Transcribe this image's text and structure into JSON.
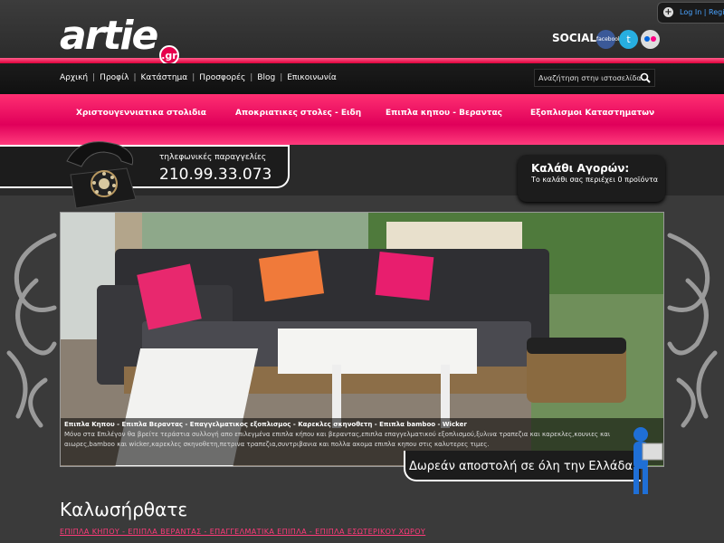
{
  "header": {
    "logo_text": "artie",
    "logo_suffix": ".gr",
    "login_links": "Log In | Regis",
    "social_label": "SOCIAL",
    "social_icons": [
      "facebook-icon",
      "twitter-icon",
      "flickr-icon"
    ],
    "facebook_text": "facebook"
  },
  "nav": {
    "items": [
      "Αρχική",
      "Προφίλ",
      "Κατάστημα",
      "Προσφορές",
      "Blog",
      "Επικοινωνία"
    ],
    "separator": "|"
  },
  "search": {
    "placeholder": "Αναζήτηση στην ιστοσελίδα..."
  },
  "categories": [
    "Χριστουγεννιατικα στολιδια",
    "Αποκριατικες στολες - Ειδη",
    "Επιπλα κηπου - Βεραντας",
    "Εξοπλισμοι Καταστηματων"
  ],
  "phone": {
    "label": "τηλεφωνικές παραγγελίες",
    "number": "210.99.33.073"
  },
  "cart": {
    "title": "Καλάθι Αγορών:",
    "subtitle": "Το καλάθι σας περιέχει 0 προϊόντα"
  },
  "banner": {
    "caption_title": "Επιπλα Κηπου - Επιπλα Βεραντας - Επαγγελματικος εξοπλισμος - Καρεκλες σκηνοθετη - Επιπλα bamboo - Wicker",
    "caption_text": "Μόνο στα Επιλέγον θα βρείτε τεράστια συλλογή απο επιλεγμένα επιπλα κήπου και βεραντας,επιπλα επαγγελματικού εξοπλισμού,ξυλινα τραπεζια και καρεκλες,κουνιες και αιωρες,bamboo και wicker,καρεκλες σκηνοθετη,πετρινα τραπεζια,συντριβανια και πολλα ακομα επιπλα κηπου στις καλυτερες τιμες."
  },
  "shipping": {
    "text": "Δωρεάν αποστολή σε όλη την Ελλάδα"
  },
  "welcome": {
    "heading": "Καλωσήρθατε",
    "links": "ΕΠΙΠΛΑ ΚΗΠΟΥ - ΕΠΙΠΛΑ ΒΕΡΑΝΤΑΣ - ΕΠΑΓΓΕΛΜΑΤΙΚΑ ΕΠΙΠΛΑ - ΕΠΙΠΛΑ ΕΣΩΤΕΡΙΚΟΥ ΧΩΡΟΥ"
  },
  "colors": {
    "accent_pink": "#e6004c",
    "background": "#3a3a3a",
    "link_blue": "#4aa3ff"
  }
}
